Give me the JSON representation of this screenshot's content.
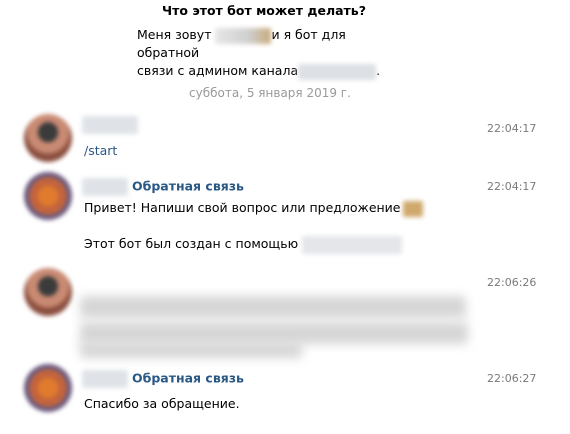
{
  "bot_info": {
    "title": "Что этот бот может делать?",
    "desc_line1_a": "Меня зовут ",
    "desc_line1_b": "и я бот для обратной",
    "desc_line2_a": "связи с админом канала",
    "desc_line2_b": "."
  },
  "date_separator": "суббота, 5 января 2019 г.",
  "messages": [
    {
      "sender": "",
      "time": "22:04:17",
      "text": "/start"
    },
    {
      "sender": "Обратная связь",
      "time": "22:04:17",
      "line1": "Привет! Напиши свой вопрос или предложение",
      "line2": "Этот бот был создан с помощью"
    },
    {
      "sender": "",
      "time": "22:06:26",
      "text": ""
    },
    {
      "sender": "Обратная связь",
      "time": "22:06:27",
      "text": "Спасибо за обращение."
    }
  ]
}
